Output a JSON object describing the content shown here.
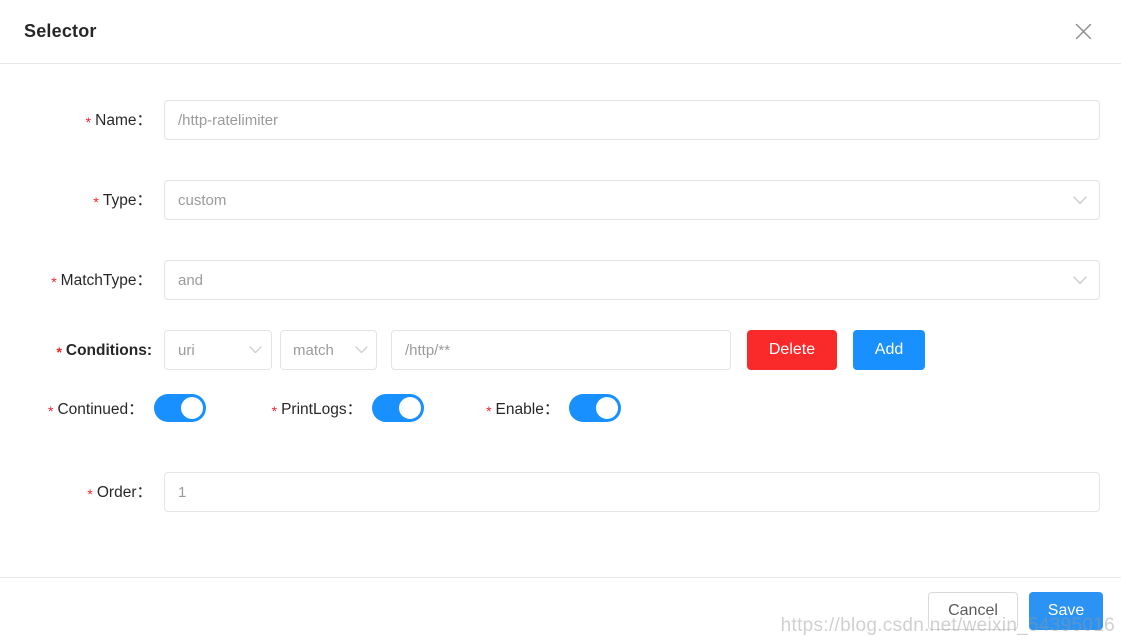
{
  "dialog": {
    "title": "Selector",
    "close_icon": "close-icon"
  },
  "form": {
    "name": {
      "label": "Name",
      "required_mark": "*",
      "value": "/http-ratelimiter"
    },
    "type": {
      "label": "Type",
      "required_mark": "*",
      "value": "custom",
      "chevron_icon": "chevron-down-icon"
    },
    "match_type": {
      "label": "MatchType",
      "required_mark": "*",
      "value": "and",
      "chevron_icon": "chevron-down-icon"
    },
    "conditions": {
      "label": "Conditions",
      "required_mark": "*",
      "param_type": "uri",
      "operator": "match",
      "value": "/http/**",
      "delete_label": "Delete",
      "add_label": "Add",
      "chevron_icon": "chevron-down-icon"
    },
    "continued": {
      "label": "Continued",
      "required_mark": "*",
      "state": "on"
    },
    "print_logs": {
      "label": "PrintLogs",
      "required_mark": "*",
      "state": "on"
    },
    "enable": {
      "label": "Enable",
      "required_mark": "*",
      "state": "on"
    },
    "order": {
      "label": "Order",
      "required_mark": "*",
      "value": "1"
    }
  },
  "footer": {
    "cancel_label": "Cancel",
    "save_label": "Save"
  },
  "watermark": {
    "text": "https://blog.csdn.net/weixin_54395016"
  },
  "colors": {
    "primary": "#1890ff",
    "danger": "#fa2a2a",
    "save": "#2b93f3",
    "required": "#f5222d",
    "border": "#e4e4e4",
    "divider": "#e8e8e8"
  }
}
